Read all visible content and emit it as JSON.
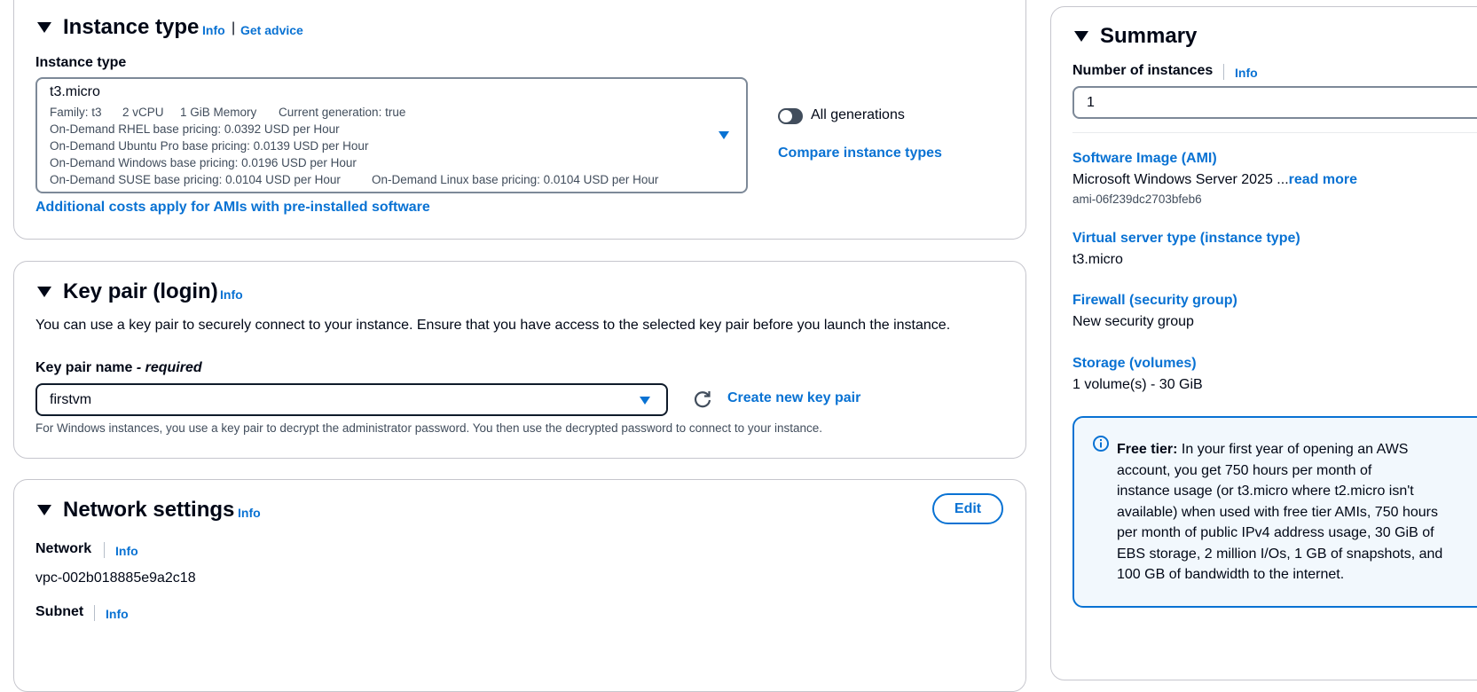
{
  "instance_type_section": {
    "title": "Instance type",
    "info": "Info",
    "separator": "|",
    "get_advice": "Get advice",
    "field_label": "Instance type",
    "selected": "t3.micro",
    "family": "Family: t3",
    "vcpu": "2 vCPU",
    "memory": "1 GiB Memory",
    "current_gen": "Current generation: true",
    "pricing_rhel": "On-Demand RHEL base pricing: 0.0392 USD per Hour",
    "pricing_ubuntu": "On-Demand Ubuntu Pro base pricing: 0.0139 USD per Hour",
    "pricing_windows": "On-Demand Windows base pricing: 0.0196 USD per Hour",
    "pricing_suse": "On-Demand SUSE base pricing: 0.0104 USD per Hour",
    "pricing_linux": "On-Demand Linux base pricing: 0.0104 USD per Hour",
    "all_generations": "All generations",
    "compare": "Compare instance types",
    "additional_costs": "Additional costs apply for AMIs with pre-installed software"
  },
  "key_pair_section": {
    "title": "Key pair (login)",
    "info": "Info",
    "description": "You can use a key pair to securely connect to your instance. Ensure that you have access to the selected key pair before you launch the instance.",
    "field_label": "Key pair name",
    "required": "- required",
    "selected": "firstvm",
    "create_new": "Create new key pair",
    "hint": "For Windows instances, you use a key pair to decrypt the administrator password. You then use the decrypted password to connect to your instance."
  },
  "network_section": {
    "title": "Network settings",
    "info": "Info",
    "edit": "Edit",
    "network_label": "Network",
    "network_info": "Info",
    "network_value": "vpc-002b018885e9a2c18",
    "subnet_label": "Subnet",
    "subnet_info": "Info"
  },
  "summary": {
    "title": "Summary",
    "num_instances_label": "Number of instances",
    "num_instances_info": "Info",
    "num_instances_value": "1",
    "ami_label": "Software Image (AMI)",
    "ami_value": "Microsoft Windows Server 2025 ...",
    "ami_read_more": "read more",
    "ami_id": "ami-06f239dc2703bfeb6",
    "server_type_label": "Virtual server type (instance type)",
    "server_type_value": "t3.micro",
    "firewall_label": "Firewall (security group)",
    "firewall_value": "New security group",
    "storage_label": "Storage (volumes)",
    "storage_value": "1 volume(s) - 30 GiB",
    "free_tier_title": "Free tier:",
    "free_tier_line1": "In your first year of opening an AWS",
    "free_tier_line2": "account, you get 750 hours per month of",
    "free_tier_line3": "instance usage (or t3.micro where t2.micro isn't",
    "free_tier_line4": "available) when used with free tier AMIs, 750 hours",
    "free_tier_line5": "per month of public IPv4 address usage, 30 GiB of",
    "free_tier_line6": "EBS storage, 2 million I/Os, 1 GB of snapshots, and",
    "free_tier_line7": "100 GB of bandwidth to the internet."
  },
  "colors": {
    "link": "#0972d3",
    "text": "#000716",
    "info_box_bg": "#f2f8fd",
    "info_box_border": "#0972d3"
  }
}
